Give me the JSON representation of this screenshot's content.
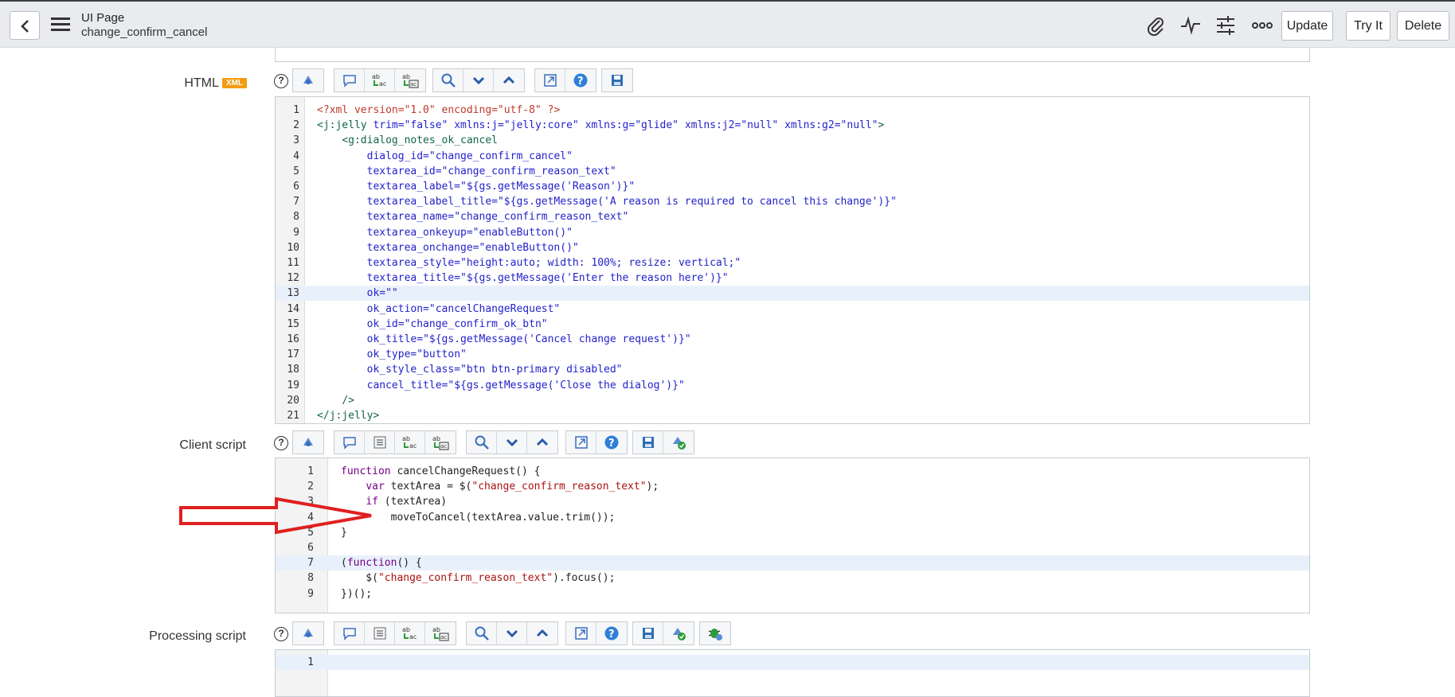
{
  "header": {
    "title": "UI Page",
    "subtitle": "change_confirm_cancel",
    "buttons": {
      "update": "Update",
      "try_it": "Try It",
      "delete": "Delete"
    }
  },
  "fields": {
    "html_label": "HTML",
    "xml_badge": "XML",
    "client_label": "Client script",
    "processing_label": "Processing script",
    "help_glyph": "?"
  },
  "html_code": [
    {
      "n": "1",
      "t": "<?xml version=\"1.0\" encoding=\"utf-8\" ?>"
    },
    {
      "n": "2",
      "t": "<j:jelly trim=\"false\" xmlns:j=\"jelly:core\" xmlns:g=\"glide\" xmlns:j2=\"null\" xmlns:g2=\"null\">"
    },
    {
      "n": "3",
      "t": "    <g:dialog_notes_ok_cancel"
    },
    {
      "n": "4",
      "t": "        dialog_id=\"change_confirm_cancel\""
    },
    {
      "n": "5",
      "t": "        textarea_id=\"change_confirm_reason_text\""
    },
    {
      "n": "6",
      "t": "        textarea_label=\"${gs.getMessage('Reason')}\""
    },
    {
      "n": "7",
      "t": "        textarea_label_title=\"${gs.getMessage('A reason is required to cancel this change')}\""
    },
    {
      "n": "8",
      "t": "        textarea_name=\"change_confirm_reason_text\""
    },
    {
      "n": "9",
      "t": "        textarea_onkeyup=\"enableButton()\""
    },
    {
      "n": "10",
      "t": "        textarea_onchange=\"enableButton()\""
    },
    {
      "n": "11",
      "t": "        textarea_style=\"height:auto; width: 100%; resize: vertical;\""
    },
    {
      "n": "12",
      "t": "        textarea_title=\"${gs.getMessage('Enter the reason here')}\""
    },
    {
      "n": "13",
      "t": "        ok=\"\""
    },
    {
      "n": "14",
      "t": "        ok_action=\"cancelChangeRequest\""
    },
    {
      "n": "15",
      "t": "        ok_id=\"change_confirm_ok_btn\""
    },
    {
      "n": "16",
      "t": "        ok_title=\"${gs.getMessage('Cancel change request')}\""
    },
    {
      "n": "17",
      "t": "        ok_type=\"button\""
    },
    {
      "n": "18",
      "t": "        ok_style_class=\"btn btn-primary disabled\""
    },
    {
      "n": "19",
      "t": "        cancel_title=\"${gs.getMessage('Close the dialog')}\""
    },
    {
      "n": "20",
      "t": "    />"
    },
    {
      "n": "21",
      "t": "</j:jelly>"
    }
  ],
  "client_code": [
    {
      "n": "1",
      "t": "function cancelChangeRequest() {"
    },
    {
      "n": "2",
      "t": "    var textArea = $(\"change_confirm_reason_text\");"
    },
    {
      "n": "3",
      "t": "    if (textArea)"
    },
    {
      "n": "4",
      "t": "        moveToCancel(textArea.value.trim());"
    },
    {
      "n": "5",
      "t": "}"
    },
    {
      "n": "6",
      "t": ""
    },
    {
      "n": "7",
      "t": "(function() {"
    },
    {
      "n": "8",
      "t": "    $(\"change_confirm_reason_text\").focus();"
    },
    {
      "n": "9",
      "t": "})();"
    }
  ],
  "processing_code": [
    {
      "n": "1",
      "t": ""
    }
  ],
  "colors": {
    "header_bg": "#e9ebee",
    "highlight": "#e8f1fb",
    "arrow": "#e02020",
    "badge": "#f39c12"
  }
}
